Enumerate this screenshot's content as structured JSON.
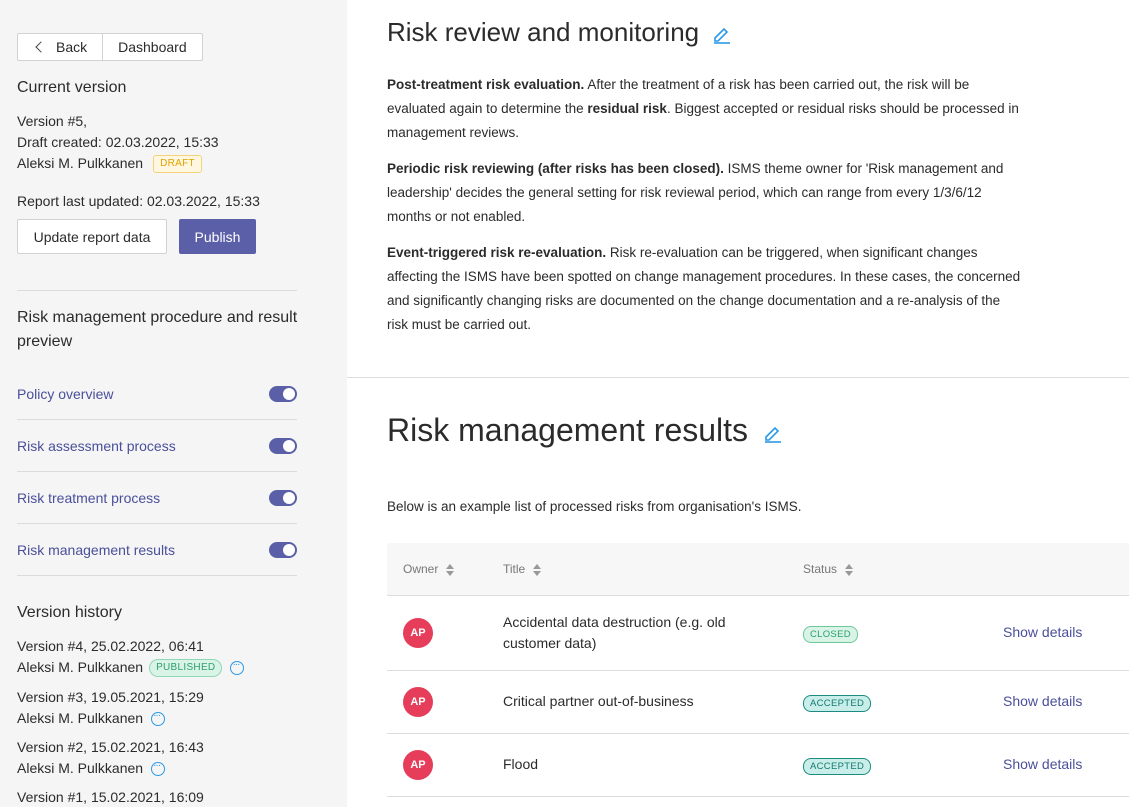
{
  "nav": {
    "back_label": "Back",
    "dashboard_label": "Dashboard"
  },
  "current_version": {
    "heading": "Current version",
    "version": "Version #5,",
    "draft_created": "Draft created: 02.03.2022, 15:33",
    "author": "Aleksi M. Pulkkanen",
    "badge": "DRAFT",
    "report_updated": "Report last updated: 02.03.2022, 15:33",
    "update_button": "Update report data",
    "publish_button": "Publish"
  },
  "procedure": {
    "heading": "Risk management procedure and result preview",
    "items": [
      {
        "label": "Policy overview",
        "enabled": true
      },
      {
        "label": "Risk assessment process",
        "enabled": true
      },
      {
        "label": "Risk treatment process",
        "enabled": true
      },
      {
        "label": "Risk management results",
        "enabled": true
      }
    ]
  },
  "history": {
    "heading": "Version history",
    "versions": [
      {
        "title": "Version #4, 25.02.2022, 06:41",
        "author": "Aleksi M. Pulkkanen",
        "badge": "PUBLISHED"
      },
      {
        "title": "Version #3, 19.05.2021, 15:29",
        "author": "Aleksi M. Pulkkanen",
        "badge": ""
      },
      {
        "title": "Version #2, 15.02.2021, 16:43",
        "author": "Aleksi M. Pulkkanen",
        "badge": ""
      },
      {
        "title": "Version #1, 15.02.2021, 16:09",
        "author": "",
        "badge": ""
      }
    ]
  },
  "review": {
    "title": "Risk review and monitoring",
    "p1_bold": "Post-treatment risk evaluation.",
    "p1_a": " After the treatment of a risk has been carried out, the risk will be evaluated again to determine the ",
    "p1_bold2": "residual risk",
    "p1_b": ". Biggest accepted or residual risks should be processed in management reviews.",
    "p2_bold": "Periodic risk reviewing (after risks has been closed).",
    "p2_a": " ISMS theme owner for 'Risk management and leadership' decides the general setting for risk reviewal period, which can range from every 1/3/6/12 months or not enabled.",
    "p3_bold": "Event-triggered risk re-evaluation.",
    "p3_a": " Risk re-evaluation can be triggered, when significant changes affecting the ISMS have been spotted on change management procedures. In these cases, the concerned and significantly changing risks are documented on the change documentation and a re-analysis of the risk must be carried out."
  },
  "results": {
    "title": "Risk management results",
    "intro": "Below is an example list of processed risks from organisation's ISMS.",
    "columns": {
      "owner": "Owner",
      "title": "Title",
      "status": "Status"
    },
    "rows": [
      {
        "owner": "AP",
        "title": "Accidental data destruction (e.g. old customer data)",
        "status": "CLOSED",
        "action": "Show details"
      },
      {
        "owner": "AP",
        "title": "Critical partner out-of-business",
        "status": "ACCEPTED",
        "action": "Show details"
      },
      {
        "owner": "AP",
        "title": "Flood",
        "status": "ACCEPTED",
        "action": "Show details"
      }
    ]
  },
  "colors": {
    "accent": "#5b5fa8",
    "avatar": "#e63d5a",
    "link": "#4a4f9a"
  }
}
